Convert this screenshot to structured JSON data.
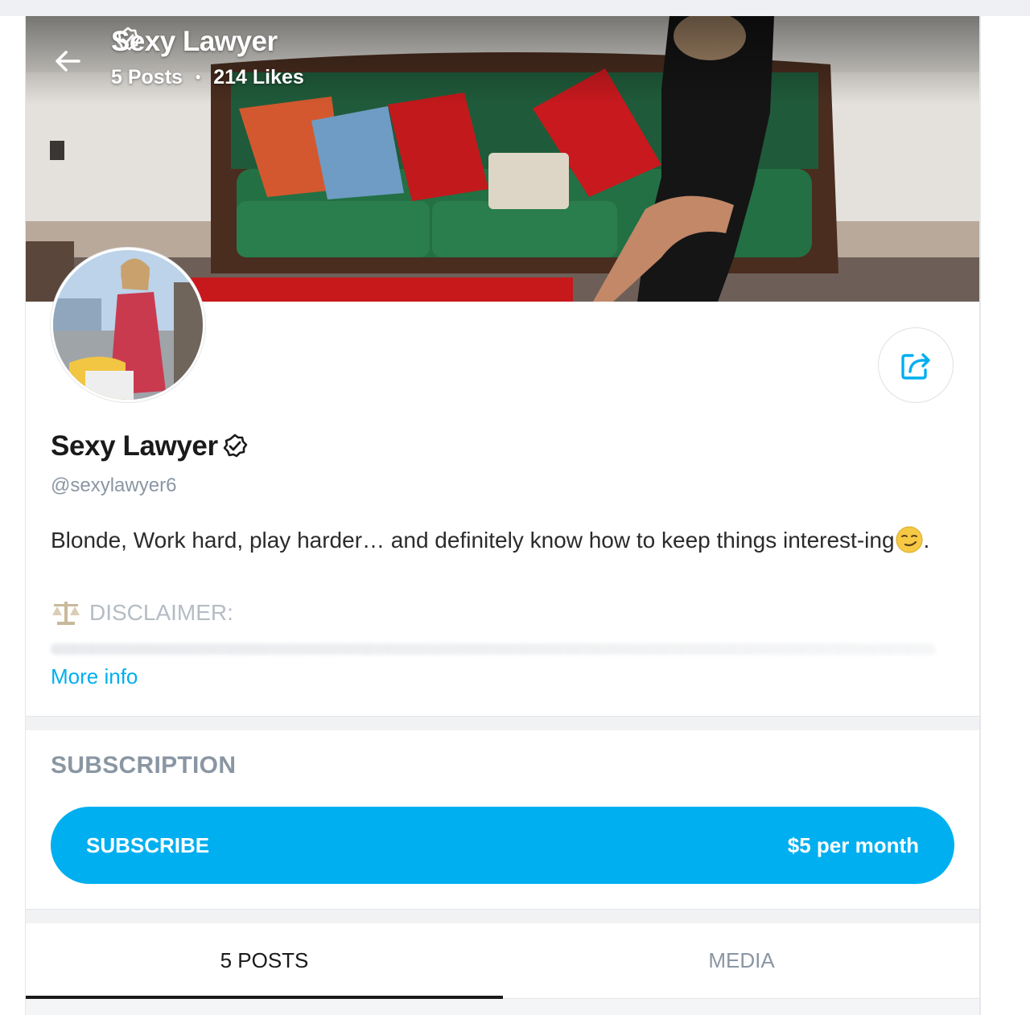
{
  "header": {
    "name": "Sexy Lawyer",
    "posts": "5 Posts",
    "separator": "•",
    "likes": "214 Likes"
  },
  "profile": {
    "name": "Sexy Lawyer",
    "username": "@sexylawyer6",
    "bio": "Blonde, Work hard, play harder… and definitely know how to keep things interest-ing",
    "bio_end": ".",
    "disclaimer": "DISCLAIMER:",
    "more_info": "More info"
  },
  "subscription": {
    "heading": "SUBSCRIPTION",
    "button_label": "SUBSCRIBE",
    "price": "$5 per month"
  },
  "tabs": [
    {
      "label": "5 POSTS",
      "active": true
    },
    {
      "label": "MEDIA",
      "active": false
    }
  ],
  "icons": {
    "back": "arrow-left-icon",
    "verified": "verified-badge-icon",
    "share": "share-icon",
    "emoji": "smirking-face-emoji",
    "scales": "balance-scale-icon"
  },
  "colors": {
    "accent": "#00aff0",
    "muted_text": "#8a96a3",
    "text": "#1a1a1a"
  }
}
